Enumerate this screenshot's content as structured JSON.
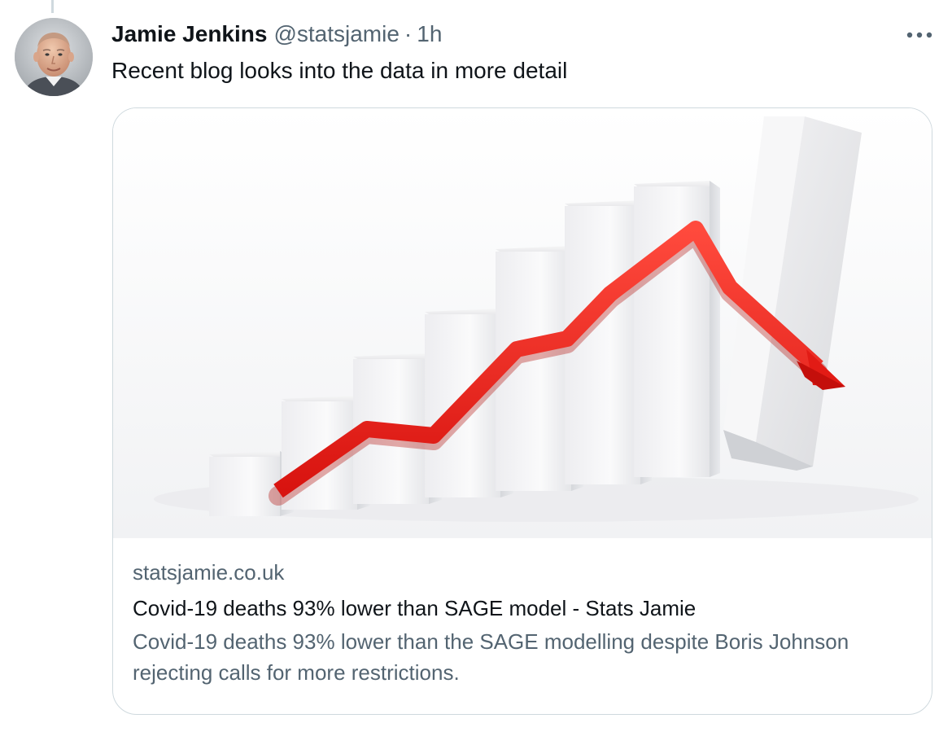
{
  "tweet": {
    "author": {
      "display_name": "Jamie Jenkins",
      "handle": "@statsjamie",
      "separator": "·",
      "time": "1h",
      "avatar_icon": "profile-photo"
    },
    "text": "Recent blog looks into the data in more detail",
    "more_icon": "more-horizontal-icon"
  },
  "link_card": {
    "domain": "statsjamie.co.uk",
    "title": "Covid-19 deaths 93% lower than SAGE model - Stats Jamie",
    "description": "Covid-19 deaths 93% lower than the SAGE modelling despite Boris Johnson rejecting calls for more restrictions.",
    "image": "3d-bar-chart-with-red-trend-arrow"
  },
  "colors": {
    "text_primary": "#0f1419",
    "text_secondary": "#536471",
    "border": "#cfd9de",
    "arrow_red": "#e8231f"
  }
}
